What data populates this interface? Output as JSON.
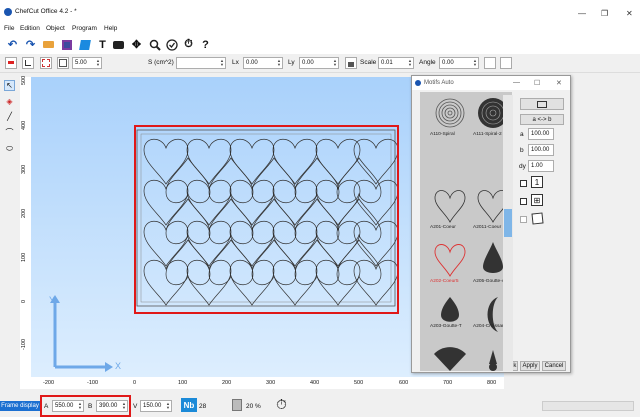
{
  "window": {
    "title": "ChefCut Office 4.2 - *",
    "minimize": "—",
    "maximize": "❐",
    "close": "✕"
  },
  "menu": [
    "File",
    "Edition",
    "Object",
    "Program",
    "Help"
  ],
  "toolbar2": {
    "stepper_value": "5.00",
    "surface_label": "S (cm^2)",
    "surface_value": "",
    "lx_label": "Lx",
    "lx_value": "0.00",
    "ly_label": "Ly",
    "ly_value": "0.00",
    "scale_label": "Scale",
    "scale_value": "0.01",
    "angle_label": "Angle",
    "angle_value": "0.00"
  },
  "rulers": {
    "vertical": [
      "500",
      "400",
      "300",
      "200",
      "100",
      "0",
      "-100"
    ],
    "horizontal": [
      "-200",
      "-100",
      "0",
      "100",
      "200",
      "300",
      "400",
      "500",
      "600",
      "700",
      "800"
    ]
  },
  "axes": {
    "x": "X",
    "y": "Y"
  },
  "motifs_panel": {
    "title": "Motifs Auto",
    "items": [
      {
        "name": "A110-Spiral",
        "icon": "spiral-outline-icon"
      },
      {
        "name": "A111-Spiral-2",
        "icon": "spiral-filled-icon"
      },
      {
        "name": "A201-Coeur",
        "icon": "heart-outline-icon"
      },
      {
        "name": "A2011-Coeur",
        "icon": "heart-outline-icon"
      },
      {
        "name": "A202-Coeur5",
        "icon": "heart-red-icon",
        "selected": true
      },
      {
        "name": "A205-Goutte-All",
        "icon": "drop-filled-icon"
      },
      {
        "name": "A203-Goutte-T",
        "icon": "drop-filled-icon"
      },
      {
        "name": "A204-Croissant",
        "icon": "crescent-icon"
      }
    ],
    "swap_label": "a <-> b",
    "fields": [
      {
        "label": "a",
        "value": "100.00"
      },
      {
        "label": "b",
        "value": "100.00"
      },
      {
        "label": "dy",
        "value": "1.00"
      }
    ],
    "option1_label": "1",
    "ok_label": "Ok",
    "apply_label": "Apply",
    "cancel_label": "Cancel"
  },
  "status": {
    "frame_display": "Frame display",
    "a_label": "A",
    "a_value": "550.00",
    "b_label": "B",
    "b_value": "390.00",
    "v_label": "V",
    "v_value": "150.00",
    "nb_label": "Nb",
    "nb_value": "28",
    "percent": "20 %"
  },
  "colors": {
    "accent": "#1b6fd1",
    "highlight": "#e01818",
    "canvas_top": "#a9d1fb",
    "canvas_bottom": "#ddeefe"
  }
}
